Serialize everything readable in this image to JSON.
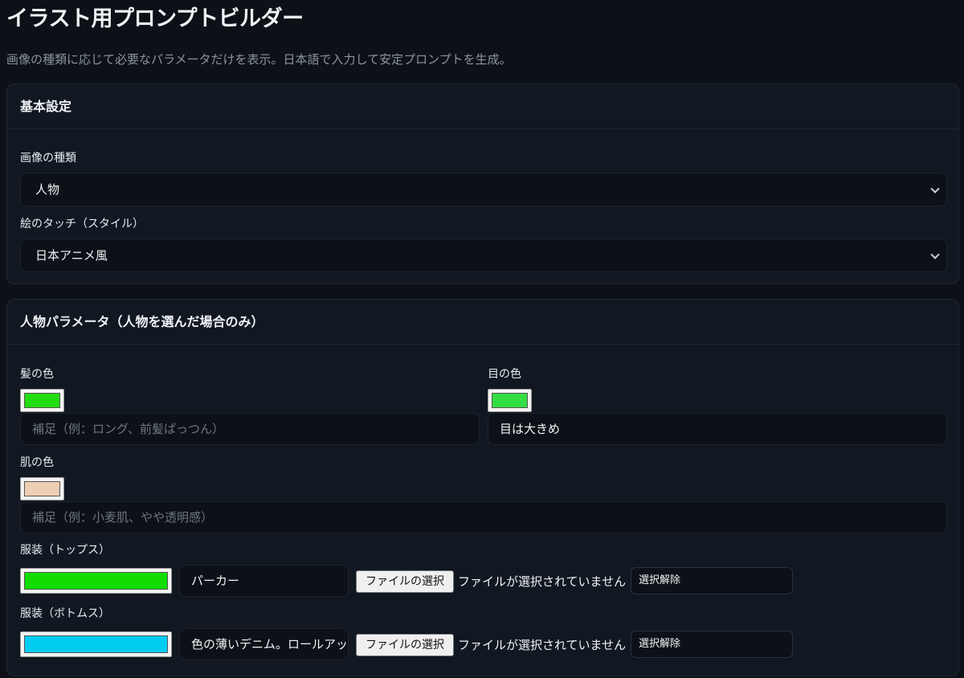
{
  "page": {
    "title": "イラスト用プロンプトビルダー",
    "subtitle": "画像の種類に応じて必要なパラメータだけを表示。日本語で入力して安定プロンプトを生成。"
  },
  "basic": {
    "title": "基本設定",
    "image_type_label": "画像の種類",
    "image_type_value": "人物",
    "style_label": "絵のタッチ（スタイル）",
    "style_value": "日本アニメ風"
  },
  "person": {
    "title": "人物パラメータ（人物を選んだ場合のみ）",
    "hair": {
      "label": "髪の色",
      "color": "#22dd11",
      "placeholder": "補足（例：ロング、前髪ぱっつん）"
    },
    "eye": {
      "label": "目の色",
      "color": "#33dd44",
      "value": "目は大きめ"
    },
    "skin": {
      "label": "肌の色",
      "color": "#efcfb4",
      "placeholder": "補足（例：小麦肌、やや透明感）"
    },
    "tops": {
      "label": "服装（トップス）",
      "color": "#11dd00",
      "value": "パーカー",
      "file_button": "ファイルの選択",
      "file_status": "ファイルが選択されていません",
      "clear_button": "選択解除"
    },
    "bottoms": {
      "label": "服装（ボトムス）",
      "color": "#00ccf0",
      "value": "色の薄いデニム。ロールアップ",
      "file_button": "ファイルの選択",
      "file_status": "ファイルが選択されていません",
      "clear_button": "選択解除"
    }
  },
  "icons": {
    "select_chevron": "chevron-down-icon"
  }
}
